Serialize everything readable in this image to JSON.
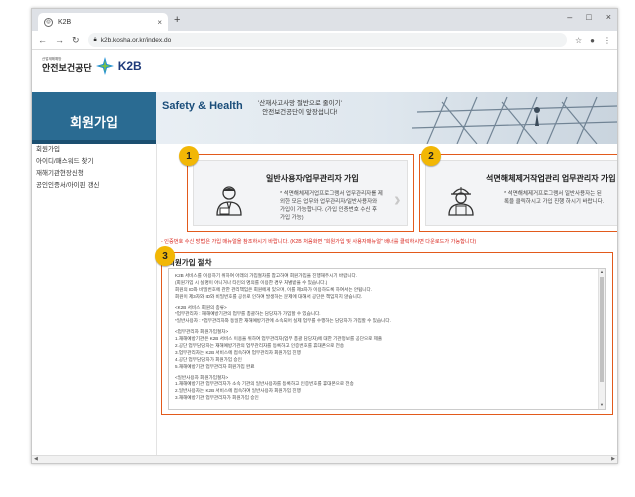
{
  "browser": {
    "tab_title": "K2B",
    "new_tab": "+",
    "tab_close": "×",
    "url": "k2b.kosha.or.kr/index.do",
    "window_controls": [
      "–",
      "□",
      "×"
    ]
  },
  "header": {
    "org_sub": "산업재해예방",
    "org_name": "안전보건공단",
    "brand": "K2B"
  },
  "banner": {
    "section_title": "회원가입",
    "headline": "Safety & Health",
    "slogan_line1": "'산재사고사망 절반으로 줄이기'",
    "slogan_line2": "안전보건공단이 앞장섭니다!"
  },
  "sidebar": {
    "items": [
      {
        "label": "회원가입"
      },
      {
        "label": "아이디/패스워드 찾기"
      },
      {
        "label": "재해기관현장신청"
      },
      {
        "label": "공인인증서/아이핀 갱신"
      }
    ]
  },
  "cards": [
    {
      "badge": "1",
      "title": "일반사용자/업무관리자 가입",
      "desc_lines": [
        "* 석면해체제거업프로그램서 업무관리자를 제",
        "외한 모든 업무와 업무관리자/일반사용자와",
        "가입이 가능합니다. (가입 인증번호 수신 후",
        "가입 가능)"
      ]
    },
    {
      "badge": "2",
      "title": "석면해체제거작업관리 업무관리자 가입",
      "desc_lines": [
        "* 석면해체제거프로그램서 일반사용자는 된",
        "록을 클릭하시고 가입 진행 하시기 바랍니다."
      ]
    }
  ],
  "notice": "- 인증번호 수신 방법은 가입 매뉴얼을 참조하시기 바랍니다. (K2B 처음화면 \"회원가입 및 사용자매뉴얼\" 배너를 클릭하시면 다운로드가 가능합니다)",
  "procedure": {
    "badge": "3",
    "title": "회원가입 절차",
    "lines": [
      "K2B 서비스를 이용하기 위하여 아래의 가입절차를 참고하여 회원가입을 진행해주시기 바랍니다.",
      "(회원가입 시 실명이 아니거나 타인의 명의를 이용한 경우 처벌받을 수 있습니다.)",
      "회원의 ID와 비밀번호에 관한 관리책임은 회원에게 있으며, 이를 제3자가 이용하도록 하여서는 안됩니다.",
      "회원이 제3자와 ID와 비밀번호를 공유로 인하여 발생하는 문제에 대해서 공단은 책임지지 않습니다.",
      "",
      "<K2B 서비스 회원의 종류>",
      "*업무관리자 : 재해예방기관의 업무를 총괄하는 담당자가 가입할 수 있습니다.",
      "*일반사용자 : *업무관리자와 동일한 재해예방기관에 소속되어 실제 업무를 수행하는 담당자가 가입할 수 있습니다.",
      "",
      "<업무관리자 회원가입절차>",
      "1.재해예방기관은 K2B 서비스 이용을 위하여 업무관리자(업무 총괄 담당자)에 대한 기관정보를 공단으로 제출",
      "2.공단 업무담당자는 재해예방기관의 업무관리자를 등록하고 인증번호를 휴대폰으로 전송",
      "3.업무관리자는 K2B 서비스에 접속하여 업무관리자 회원가입 진행",
      "4.공단 업무담당자가 회원가입 승인",
      "5.재해예방기관 업무관리자 회원가입 완료",
      "",
      "<일반사용자 회원가입절차>",
      "1.재해예방기관 업무관리자가 소속 기관의 일반사용자를 등록하고 인증번호를 휴대폰으로 전송",
      "2.일반사용자는 K2B 서비스에 접속하여 일반사용자 회원가입 진행",
      "3.재해예방기관 업무관리자가 회원가입 승인"
    ]
  }
}
